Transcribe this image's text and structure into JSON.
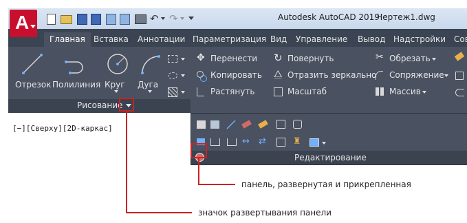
{
  "app": {
    "title": "Autodesk AutoCAD 2019",
    "document": "Чертеж1.dwg",
    "logo_letter": "A"
  },
  "tabs": [
    {
      "label": "Главная",
      "active": true
    },
    {
      "label": "Вставка"
    },
    {
      "label": "Аннотации"
    },
    {
      "label": "Параметризация"
    },
    {
      "label": "Вид"
    },
    {
      "label": "Управление"
    },
    {
      "label": "Вывод"
    },
    {
      "label": "Надстройки"
    },
    {
      "label": "Сов"
    }
  ],
  "draw_panel": {
    "title": "Рисование",
    "tools": [
      {
        "label": "Отрезок",
        "icon": "line-icon"
      },
      {
        "label": "Полилиния",
        "icon": "polyline-icon"
      },
      {
        "label": "Круг",
        "icon": "circle-icon"
      },
      {
        "label": "Дуга",
        "icon": "arc-icon"
      }
    ]
  },
  "modify_panel": {
    "title": "Редактирование",
    "col1": [
      "Перенести",
      "Копировать",
      "Растянуть"
    ],
    "col2": [
      "Повернуть",
      "Отразить зеркально",
      "Масштаб"
    ],
    "col3": [
      "Обрезать",
      "Сопряжение",
      "Массив"
    ]
  },
  "viewport": {
    "label": "[−][Сверху][2D-каркас]"
  },
  "callouts": {
    "expanded_pinned": "панель, развернутая и прикрепленная",
    "expand_icon": "значок развертывания панели"
  },
  "colors": {
    "ribbon": "#4a5160",
    "tabbar": "#3b4452",
    "highlight": "#cc2222",
    "logo": "#c8102e"
  }
}
